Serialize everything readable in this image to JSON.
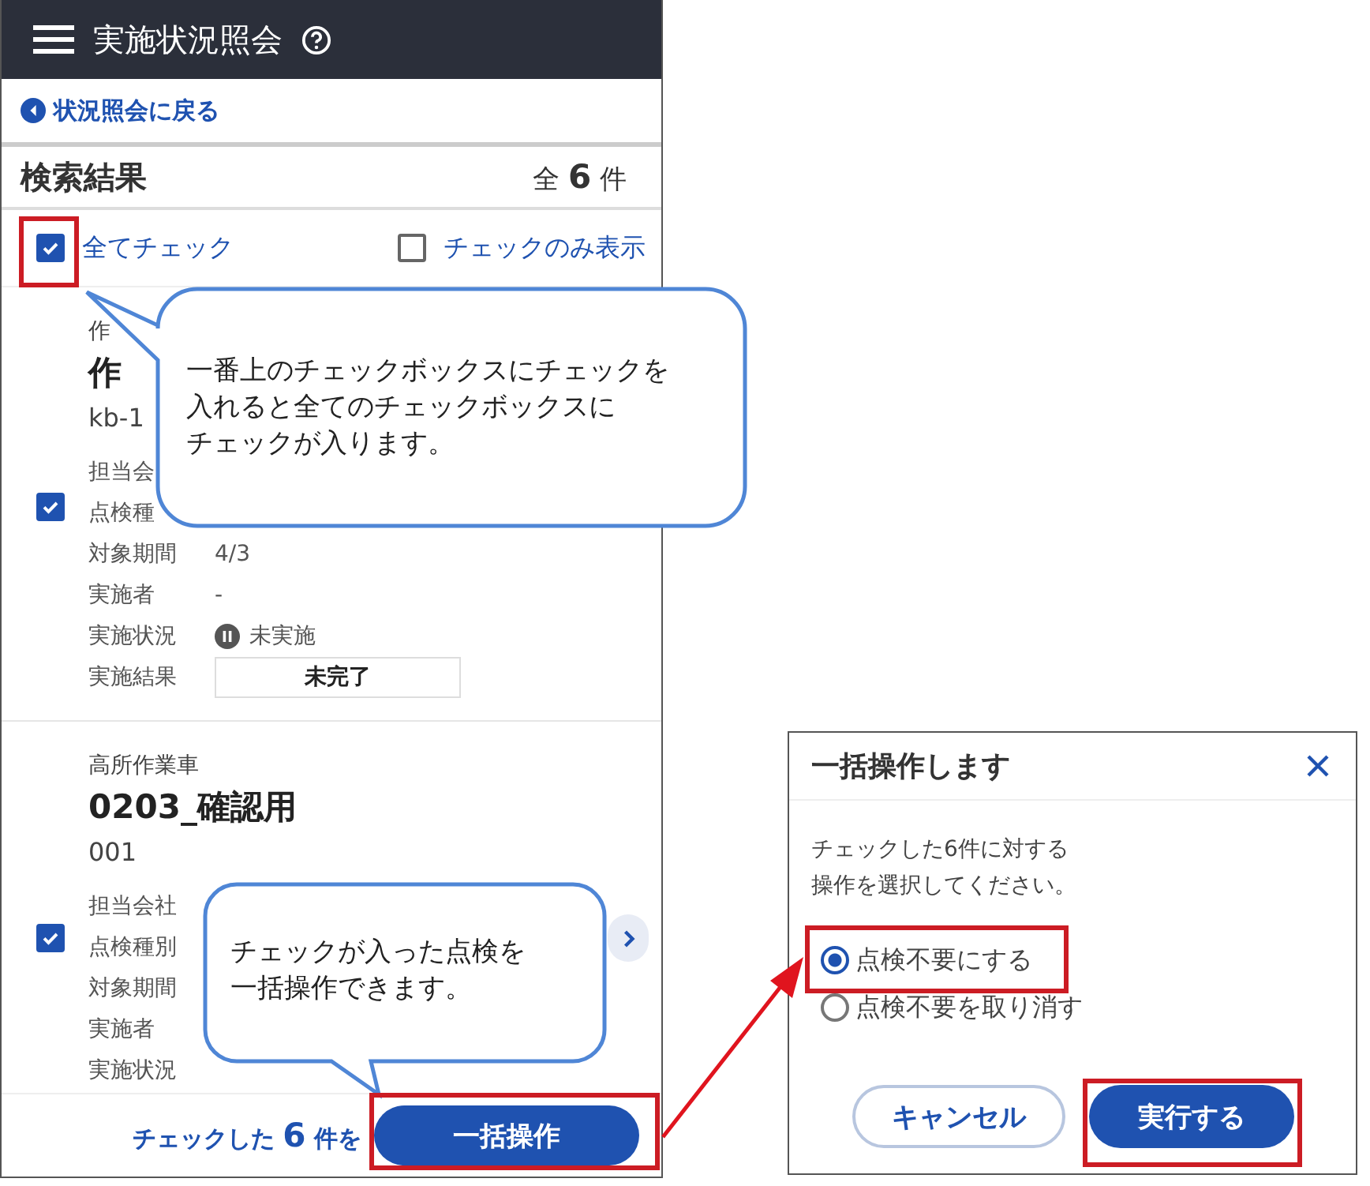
{
  "header": {
    "title": "実施状況照会"
  },
  "back_link": "状況照会に戻る",
  "results": {
    "title": "検索結果",
    "total_prefix": "全",
    "total_count": "6",
    "total_suffix": "件"
  },
  "check_all": {
    "label": "全てチェック",
    "checked": true
  },
  "checked_only": {
    "label": "チェックのみ表示",
    "checked": false
  },
  "cards": [
    {
      "category": "作",
      "name": "作",
      "code": "kb-1",
      "checked": true,
      "has_detail": false,
      "fields": [
        {
          "label": "担当会"
        },
        {
          "label": "点検種"
        },
        {
          "label": "対象期間",
          "value": "4/3",
          "kind": "text"
        },
        {
          "label": "実施者",
          "value": "-",
          "kind": "text"
        },
        {
          "label": "実施状況",
          "value": "未実施",
          "kind": "status"
        },
        {
          "label": "実施結果",
          "value": "未完了",
          "kind": "result"
        }
      ]
    },
    {
      "category": "高所作業車",
      "name": "0203_確認用",
      "code": "001",
      "checked": true,
      "has_detail": true,
      "fields": [
        {
          "label": "担当会社"
        },
        {
          "label": "点検種別"
        },
        {
          "label": "対象期間"
        },
        {
          "label": "実施者"
        },
        {
          "label": "実施状況"
        }
      ]
    }
  ],
  "footer": {
    "prefix": "チェックした",
    "count": "6",
    "suffix": "件を",
    "button": "一括操作"
  },
  "callouts": [
    [
      "一番上のチェックボックスにチェックを",
      "入れると全てのチェックボックスに",
      "チェックが入ります。"
    ],
    [
      "チェックが入った点検を",
      "一括操作できます。"
    ]
  ],
  "dialog": {
    "title": "一括操作します",
    "message": [
      "チェックした6件に対する",
      "操作を選択してください。"
    ],
    "options": [
      {
        "label": "点検不要にする",
        "selected": true
      },
      {
        "label": "点検不要を取り消す",
        "selected": false
      }
    ],
    "cancel": "キャンセル",
    "submit": "実行する"
  }
}
